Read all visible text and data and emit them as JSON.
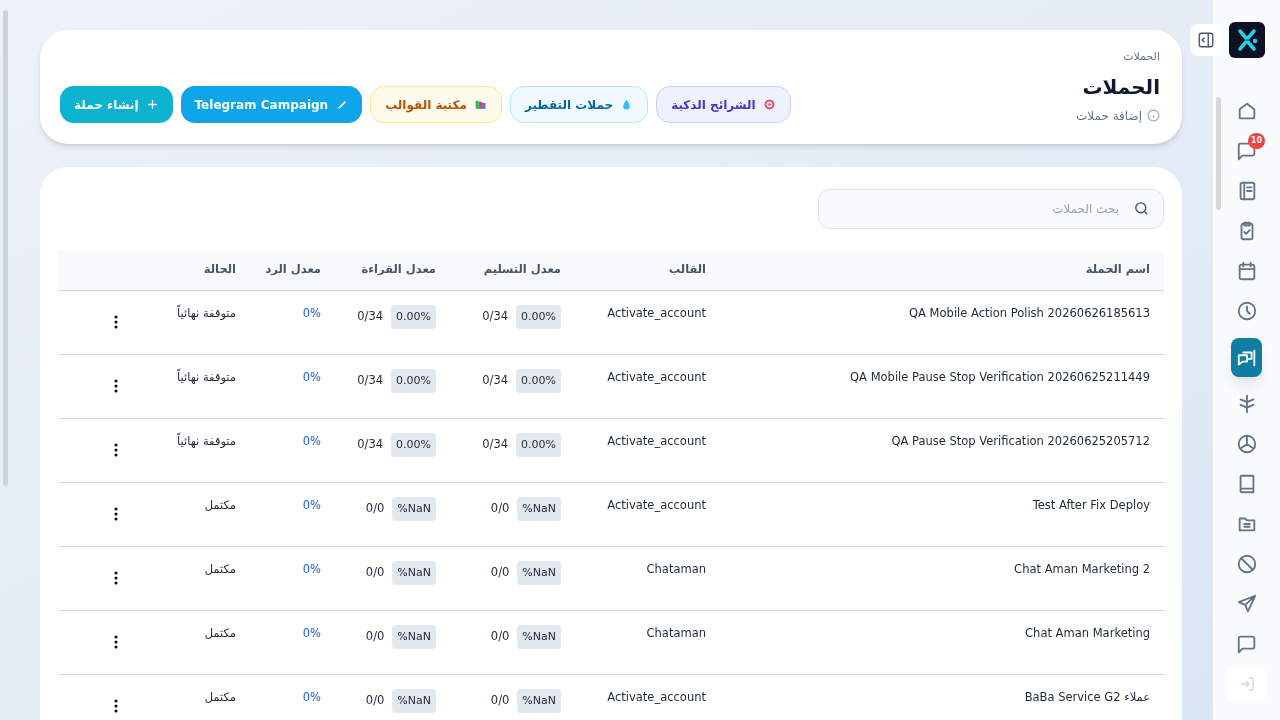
{
  "sidebar": {
    "items": [
      {
        "selected": false
      },
      {
        "selected": false,
        "badge": "10"
      },
      {
        "selected": false
      },
      {
        "selected": false
      },
      {
        "selected": false
      },
      {
        "selected": false
      },
      {
        "selected": true
      },
      {
        "selected": false
      },
      {
        "selected": false
      },
      {
        "selected": false
      },
      {
        "selected": false
      },
      {
        "selected": false
      },
      {
        "selected": false
      },
      {
        "selected": false
      }
    ]
  },
  "header": {
    "breadcrumb": "الحملات",
    "title": "الحملات",
    "subtitle": "إضافة حملات",
    "buttons": [
      {
        "kind": "segments",
        "label": "الشرائح الذكية"
      },
      {
        "kind": "drip",
        "label": "حملات التقطير"
      },
      {
        "kind": "library",
        "label": "مكتبة القوالب"
      },
      {
        "kind": "telegram",
        "label": "Telegram Campaign"
      },
      {
        "kind": "create",
        "label": "إنشاء حملة"
      }
    ]
  },
  "search": {
    "placeholder": "بحث الحملات"
  },
  "table": {
    "columns": [
      "اسم الحملة",
      "القالب",
      "معدل التسليم",
      "معدل القراءة",
      "معدل الرد",
      "الحالة"
    ],
    "rows": [
      {
        "name": "QA Mobile Action Polish 20260626185613",
        "template": "Activate_account",
        "delivery_rate": "0.00%",
        "delivered": "0/34",
        "read_rate": "0.00%",
        "read": "0/34",
        "reply_rate": "0%",
        "status": "متوقفة نهائياً"
      },
      {
        "name": "QA Mobile Pause Stop Verification 20260625211449",
        "template": "Activate_account",
        "delivery_rate": "0.00%",
        "delivered": "0/34",
        "read_rate": "0.00%",
        "read": "0/34",
        "reply_rate": "0%",
        "status": "متوقفة نهائياً"
      },
      {
        "name": "QA Pause Stop Verification 20260625205712",
        "template": "Activate_account",
        "delivery_rate": "0.00%",
        "delivered": "0/34",
        "read_rate": "0.00%",
        "read": "0/34",
        "reply_rate": "0%",
        "status": "متوقفة نهائياً"
      },
      {
        "name": "Test After Fix Deploy",
        "template": "Activate_account",
        "delivery_rate": "NaN%",
        "delivered": "0/0",
        "read_rate": "NaN%",
        "read": "0/0",
        "reply_rate": "0%",
        "status": "مكتمل"
      },
      {
        "name": "Chat Aman Marketing 2",
        "template": "Chataman",
        "delivery_rate": "NaN%",
        "delivered": "0/0",
        "read_rate": "NaN%",
        "read": "0/0",
        "reply_rate": "0%",
        "status": "مكتمل"
      },
      {
        "name": "Chat Aman Marketing",
        "template": "Chataman",
        "delivery_rate": "NaN%",
        "delivered": "0/0",
        "read_rate": "NaN%",
        "read": "0/0",
        "reply_rate": "0%",
        "status": "مكتمل"
      },
      {
        "name": "عملاء BaBa Service G2",
        "template": "Activate_account",
        "delivery_rate": "NaN%",
        "delivered": "0/0",
        "read_rate": "NaN%",
        "read": "0/0",
        "reply_rate": "0%",
        "status": "مكتمل"
      }
    ]
  }
}
